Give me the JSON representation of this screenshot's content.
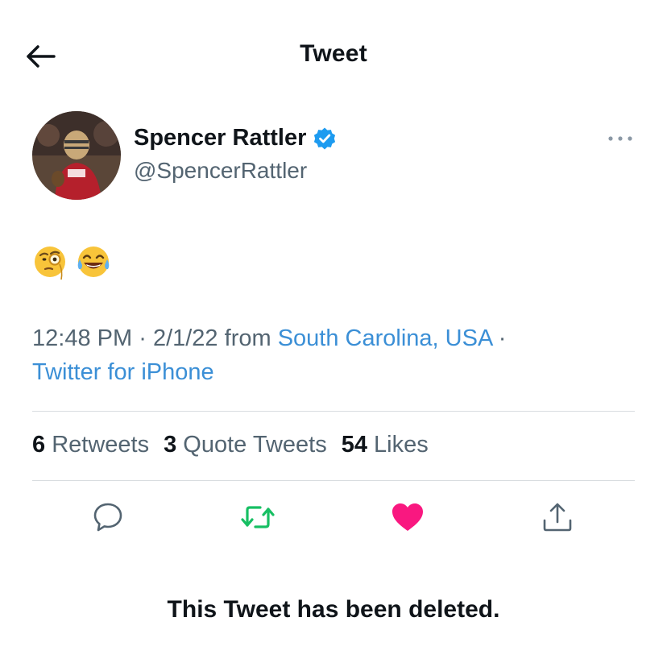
{
  "header": {
    "title": "Tweet",
    "back_icon": "arrow-left-icon"
  },
  "tweet": {
    "author": {
      "name": "Spencer Rattler",
      "handle": "@SpencerRattler",
      "verified": true,
      "avatar_icon": "profile-photo"
    },
    "emojis": [
      "face-with-monocle-emoji",
      "face-with-tears-of-joy-emoji"
    ],
    "time": "12:48 PM",
    "date": "2/1/22",
    "from_label": "from",
    "location": "South Carolina, USA",
    "client": "Twitter for iPhone",
    "separator": "·"
  },
  "stats": {
    "retweets": {
      "count": "6",
      "label": "Retweets"
    },
    "quote_tweets": {
      "count": "3",
      "label": "Quote Tweets"
    },
    "likes": {
      "count": "54",
      "label": "Likes"
    }
  },
  "actions": [
    {
      "name": "reply",
      "icon": "reply-icon"
    },
    {
      "name": "retweet",
      "icon": "retweet-icon",
      "color": "#17bf63"
    },
    {
      "name": "like",
      "icon": "heart-icon",
      "color": "#f91880",
      "active": true
    },
    {
      "name": "share",
      "icon": "share-icon"
    }
  ],
  "colors": {
    "accent": "#3b8fd6",
    "text": "#0f1419",
    "muted": "#536471"
  },
  "footer": {
    "notice": "This Tweet has been deleted."
  }
}
